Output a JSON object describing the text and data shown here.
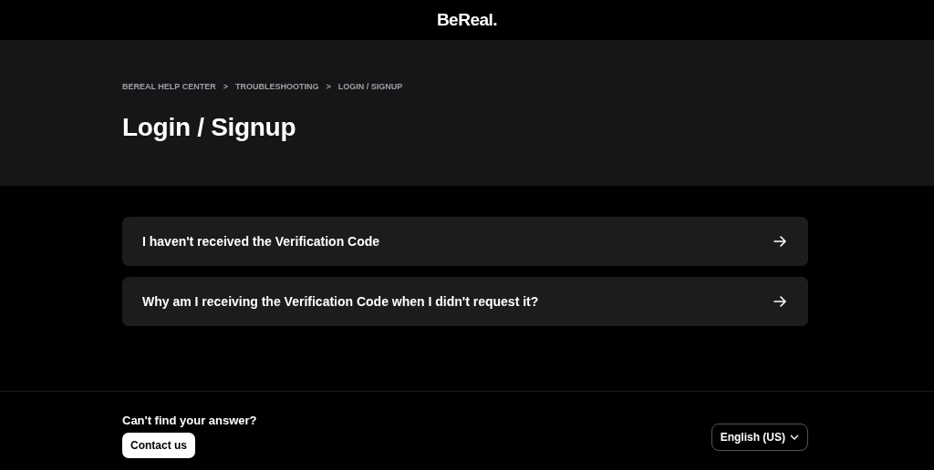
{
  "header": {
    "logo": "BeReal."
  },
  "breadcrumb": [
    {
      "label": "BEREAL HELP CENTER"
    },
    {
      "label": "TROUBLESHOOTING"
    },
    {
      "label": "LOGIN / SIGNUP"
    }
  ],
  "breadcrumb_separator": ">",
  "title": "Login / Signup",
  "articles": [
    {
      "title": "I haven't received the Verification Code"
    },
    {
      "title": "Why am I receiving the Verification Code when I didn't request it?"
    }
  ],
  "footer": {
    "question": "Can't find your answer?",
    "contact_button": "Contact us",
    "language": "English (US)"
  }
}
